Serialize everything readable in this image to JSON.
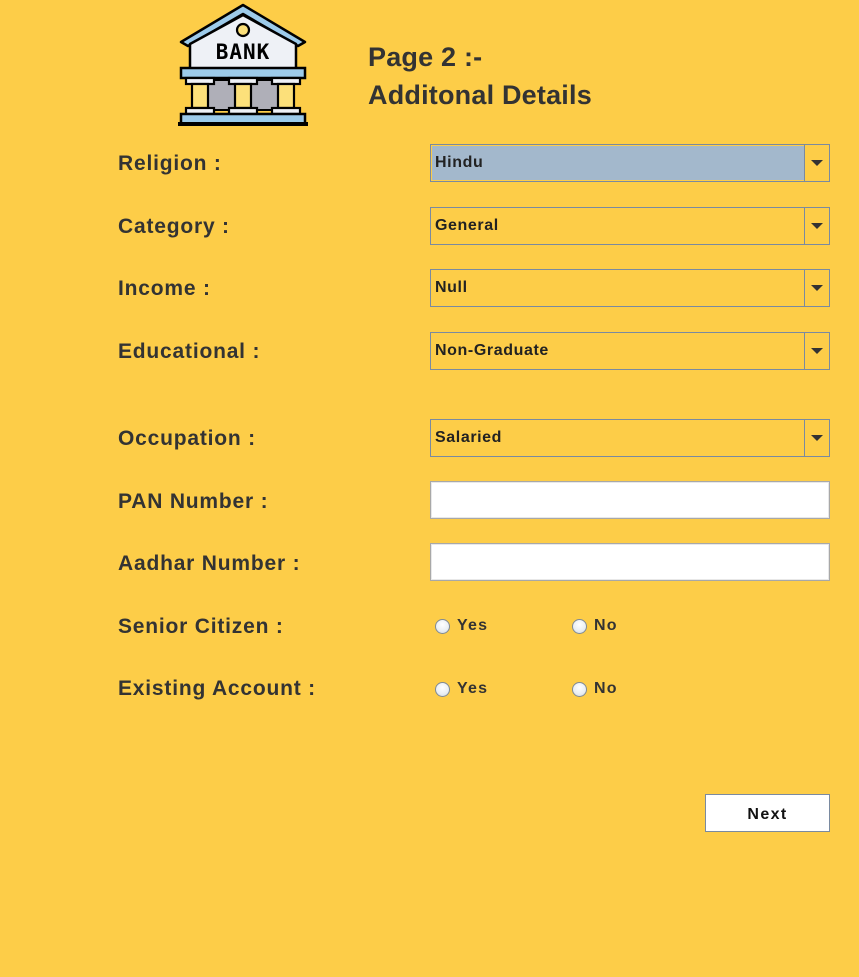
{
  "header": {
    "page_line": "Page 2 :-",
    "title_line": "Additonal Details",
    "logo_text": "BANK",
    "logo_icon": "bank-building-icon"
  },
  "form": {
    "religion": {
      "label": "Religion :",
      "value": "Hindu"
    },
    "category": {
      "label": "Category :",
      "value": "General"
    },
    "income": {
      "label": "Income :",
      "value": "Null"
    },
    "educational": {
      "label": "Educational :",
      "value": "Non-Graduate"
    },
    "occupation": {
      "label": "Occupation :",
      "value": "Salaried"
    },
    "pan": {
      "label": "PAN Number :",
      "value": ""
    },
    "aadhar": {
      "label": "Aadhar Number :",
      "value": ""
    },
    "senior_citizen": {
      "label": "Senior Citizen :",
      "yes": "Yes",
      "no": "No"
    },
    "existing_account": {
      "label": "Existing Account :",
      "yes": "Yes",
      "no": "No"
    }
  },
  "actions": {
    "next_label": "Next"
  }
}
